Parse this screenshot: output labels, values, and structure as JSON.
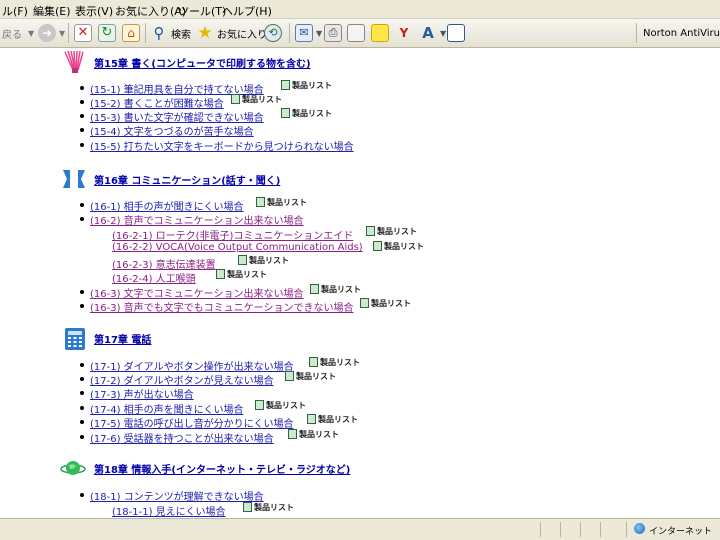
{
  "menu": [
    "ル(F)",
    "編集(E)",
    "表示(V)",
    "お気に入り(A)",
    "ツール(T)",
    "ヘルプ(H)"
  ],
  "toolbar": {
    "back_label": "戻る",
    "search_label": "検索",
    "favorites_label": "お気に入り",
    "norton_label": "Norton AntiVirus"
  },
  "product_list_label": "製品リスト",
  "colors": {
    "link": "#2020b0",
    "visited": "#8a2088",
    "chapter": "#0000aa"
  },
  "chapters": [
    {
      "title": "第15章 書く(コンピュータで印刷する物を含む)",
      "icon": "pen-icon",
      "items": [
        {
          "label": "(15-1) 筆記用具を自分で持てない場合",
          "has_list": true,
          "level": 1
        },
        {
          "label": "(15-2) 書くことが困難な場合",
          "has_list": true,
          "level": 1
        },
        {
          "label": "(15-3) 書いた文字が確認できない場合",
          "has_list": true,
          "level": 1
        },
        {
          "label": "(15-4) 文字をつづるのが苦手な場合",
          "has_list": false,
          "level": 1
        },
        {
          "label": "(15-5) 打ちたい文字をキーボードから見つけられない場合",
          "has_list": false,
          "level": 1
        }
      ]
    },
    {
      "title": "第16章 コミュニケーション(話す・聞く)",
      "icon": "speech-icon",
      "items": [
        {
          "label": "(16-1) 相手の声が聞きにくい場合",
          "has_list": true,
          "level": 1
        },
        {
          "label": "(16-2) 音声でコミュニケーション出来ない場合",
          "has_list": false,
          "level": 1
        },
        {
          "label": "(16-2-1) ローテク(非電子)コミュニケーションエイド",
          "has_list": true,
          "level": 2
        },
        {
          "label": "(16-2-2) VOCA(Voice Output Communication Aids)",
          "has_list": true,
          "level": 2
        },
        {
          "label": "(16-2-3) 意志伝達装置",
          "has_list": true,
          "level": 2
        },
        {
          "label": "(16-2-4) 人工喉頭",
          "has_list": true,
          "level": 2
        },
        {
          "label": "(16-3) 文字でコミュニケーション出来ない場合",
          "has_list": true,
          "level": 1
        },
        {
          "label": "(16-3) 音声でも文字でもコミュニケーションできない場合",
          "has_list": true,
          "level": 1
        }
      ]
    },
    {
      "title": "第17章 電話",
      "icon": "phone-icon",
      "items": [
        {
          "label": "(17-1) ダイアルやボタン操作が出来ない場合",
          "has_list": true,
          "level": 1
        },
        {
          "label": "(17-2) ダイアルやボタンが見えない場合",
          "has_list": true,
          "level": 1
        },
        {
          "label": "(17-3) 声が出ない場合",
          "has_list": false,
          "level": 1
        },
        {
          "label": "(17-4) 相手の声を聞きにくい場合",
          "has_list": true,
          "level": 1
        },
        {
          "label": "(17-5) 電話の呼び出し音が分かりにくい場合",
          "has_list": true,
          "level": 1
        },
        {
          "label": "(17-6) 受話器を持つことが出来ない場合",
          "has_list": true,
          "level": 1
        }
      ]
    },
    {
      "title": "第18章 情報入手(インターネット・テレビ・ラジオなど)",
      "icon": "globe-icon",
      "items": [
        {
          "label": "(18-1) コンテンツが理解できない場合",
          "has_list": false,
          "level": 1
        },
        {
          "label": "(18-1-1) 見えにくい場合",
          "has_list": true,
          "level": 2
        }
      ]
    }
  ],
  "status": {
    "zone": "インターネット"
  }
}
